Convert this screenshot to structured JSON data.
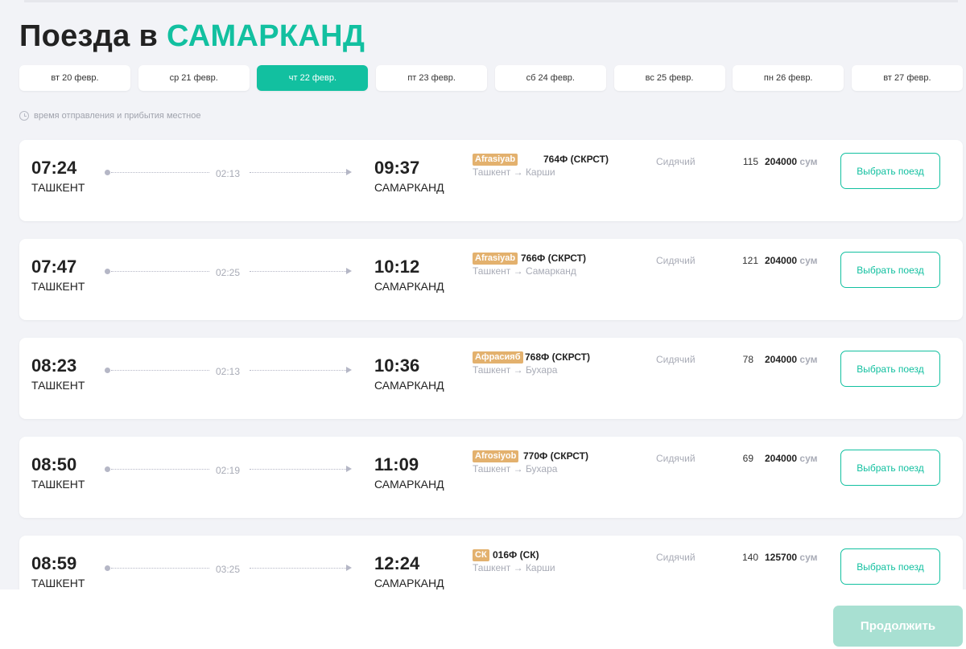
{
  "page": {
    "title_prefix": "Поезда в",
    "title_city": "САМАРКАНД",
    "note": "время отправления и прибытия местное"
  },
  "dates": [
    {
      "label": "вт 20 февр.",
      "active": false
    },
    {
      "label": "ср 21 февр.",
      "active": false
    },
    {
      "label": "чт 22 февр.",
      "active": true
    },
    {
      "label": "пт 23 февр.",
      "active": false
    },
    {
      "label": "сб 24 февр.",
      "active": false
    },
    {
      "label": "вс 25 февр.",
      "active": false
    },
    {
      "label": "пн 26 февр.",
      "active": false
    },
    {
      "label": "вт 27 февр.",
      "active": false
    }
  ],
  "trains": [
    {
      "dep_time": "07:24",
      "dep_city": "ТАШКЕНТ",
      "duration": "02:13",
      "arr_time": "09:37",
      "arr_city": "САМАРКАНД",
      "brand": "Afrasiyab",
      "train_no": "764Ф (СКРСТ)",
      "segment": "Ташкент → Карши",
      "car_class": "Сидячий",
      "seats": "115",
      "price": "204000",
      "currency": "сум",
      "button": "Выбрать поезд"
    },
    {
      "dep_time": "07:47",
      "dep_city": "ТАШКЕНТ",
      "duration": "02:25",
      "arr_time": "10:12",
      "arr_city": "САМАРКАНД",
      "brand": "Afrasiyab",
      "train_no": "766Ф (СКРСТ)",
      "segment": "Ташкент → Самарканд",
      "car_class": "Сидячий",
      "seats": "121",
      "price": "204000",
      "currency": "сум",
      "button": "Выбрать поезд"
    },
    {
      "dep_time": "08:23",
      "dep_city": "ТАШКЕНТ",
      "duration": "02:13",
      "arr_time": "10:36",
      "arr_city": "САМАРКАНД",
      "brand": "Афрасияб",
      "train_no": "768Ф (СКРСТ)",
      "segment": "Ташкент → Бухара",
      "car_class": "Сидячий",
      "seats": "78",
      "price": "204000",
      "currency": "сум",
      "button": "Выбрать поезд"
    },
    {
      "dep_time": "08:50",
      "dep_city": "ТАШКЕНТ",
      "duration": "02:19",
      "arr_time": "11:09",
      "arr_city": "САМАРКАНД",
      "brand": "Afrosiyob",
      "train_no": "770Ф (СКРСТ)",
      "segment": "Ташкент → Бухара",
      "car_class": "Сидячий",
      "seats": "69",
      "price": "204000",
      "currency": "сум",
      "button": "Выбрать поезд"
    },
    {
      "dep_time": "08:59",
      "dep_city": "ТАШКЕНТ",
      "duration": "03:25",
      "arr_time": "12:24",
      "arr_city": "САМАРКАНД",
      "brand": "СК",
      "train_no": "016Ф (СК)",
      "segment": "Ташкент → Карши",
      "car_class": "Сидячий",
      "seats": "140",
      "price": "125700",
      "currency": "сум",
      "button": "Выбрать поезд"
    }
  ],
  "footer": {
    "continue_label": "Продолжить"
  },
  "colors": {
    "accent": "#12c0a0",
    "brand_badge": "#e3b16e",
    "continue_disabled": "#a8e0d2"
  }
}
